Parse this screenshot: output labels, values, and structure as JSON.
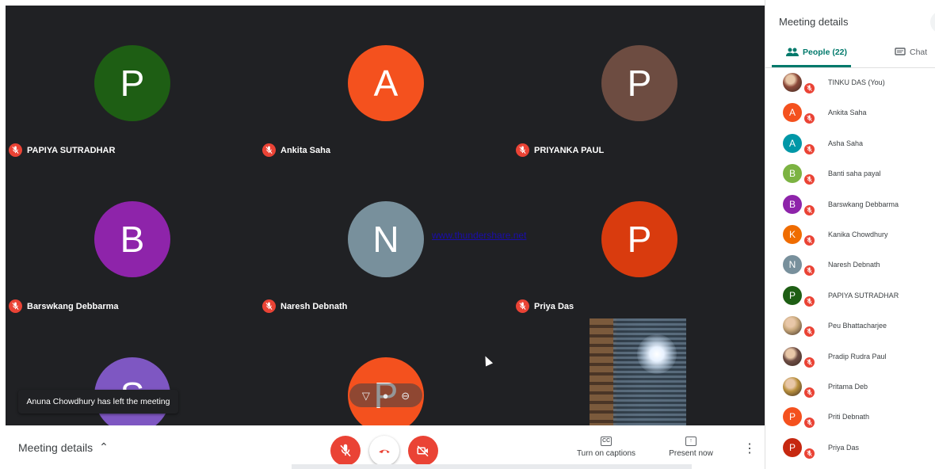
{
  "grid": {
    "tiles": [
      {
        "initial": "P",
        "name": "PAPIYA SUTRADHAR",
        "color": "#1e5e14"
      },
      {
        "initial": "A",
        "name": "Ankita Saha",
        "color": "#f4511e"
      },
      {
        "initial": "P",
        "name": "PRIYANKA PAUL",
        "color": "#6d4c41"
      },
      {
        "initial": "B",
        "name": "Barswkang Debbarma",
        "color": "#8e24aa"
      },
      {
        "initial": "N",
        "name": "Naresh Debnath",
        "color": "#78909c"
      },
      {
        "initial": "P",
        "name": "Priya Das",
        "color": "#d93b0e"
      },
      {
        "initial": "S",
        "name": "",
        "color": "#7e57c2"
      },
      {
        "initial": "P",
        "name": "",
        "color": "#f4511e"
      }
    ],
    "watermark": "www.thundershare.net",
    "toast": "Anuna Chowdhury has left the meeting"
  },
  "bottom_bar": {
    "meeting_details": "Meeting details",
    "captions_label": "Turn on captions",
    "captions_icon": "CC",
    "present_label": "Present now"
  },
  "panel": {
    "title": "Meeting details",
    "people_tab": "People (22)",
    "chat_tab": "Chat",
    "people": [
      {
        "name": "TINKU DAS (You)",
        "initial": "",
        "color": "#8d4a3a",
        "photo": true
      },
      {
        "name": "Ankita Saha",
        "initial": "A",
        "color": "#f4511e"
      },
      {
        "name": "Asha Saha",
        "initial": "A",
        "color": "#0097a7"
      },
      {
        "name": "Banti saha payal",
        "initial": "B",
        "color": "#7cb342"
      },
      {
        "name": "Barswkang Debbarma",
        "initial": "B",
        "color": "#8e24aa"
      },
      {
        "name": "Kanika Chowdhury",
        "initial": "K",
        "color": "#ef6c00"
      },
      {
        "name": "Naresh Debnath",
        "initial": "N",
        "color": "#78909c"
      },
      {
        "name": "PAPIYA SUTRADHAR",
        "initial": "P",
        "color": "#1e5e14"
      },
      {
        "name": "Peu Bhattacharjee",
        "initial": "",
        "color": "#c7a77a",
        "photo": true
      },
      {
        "name": "Pradip Rudra Paul",
        "initial": "",
        "color": "#6f4e45",
        "photo": true
      },
      {
        "name": "Pritama Deb",
        "initial": "",
        "color": "#b9903e",
        "photo": true
      },
      {
        "name": "Priti Debnath",
        "initial": "P",
        "color": "#f4511e"
      },
      {
        "name": "Priya Das",
        "initial": "P",
        "color": "#c62810"
      }
    ]
  },
  "colors": {
    "accent": "#00796b",
    "danger": "#ea4335",
    "grid_bg": "#202124"
  }
}
